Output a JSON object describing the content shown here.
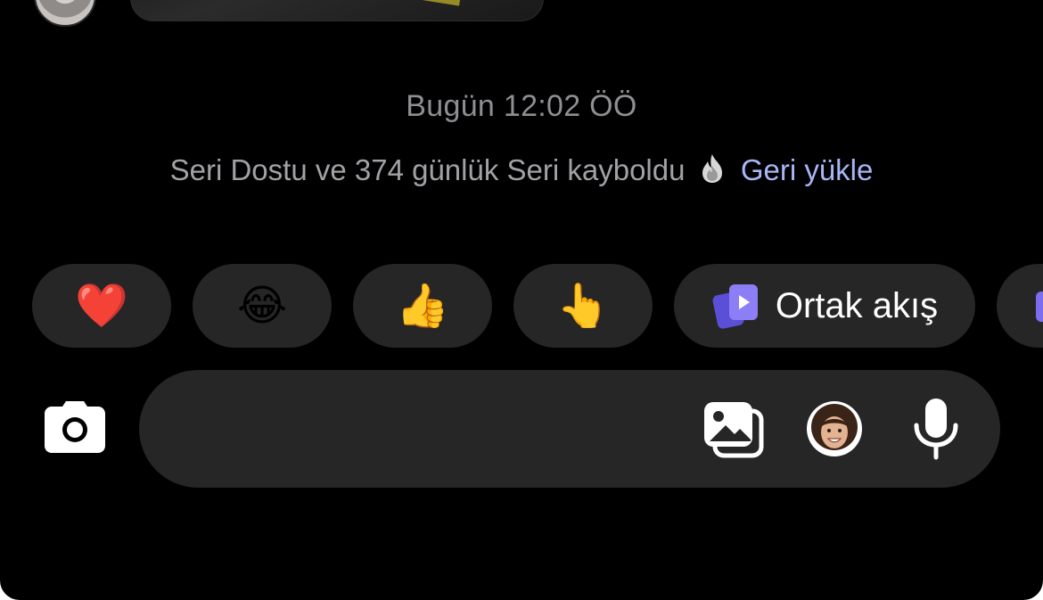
{
  "thread": {
    "timestamp": "Bugün 12:02 ÖÖ",
    "notice": {
      "text": "Seri Dostu ve 374 günlük Seri kayboldu",
      "icon": "fire-icon",
      "action_label": "Geri yükle"
    }
  },
  "quick_reactions": [
    {
      "name": "heart",
      "emoji": "❤️"
    },
    {
      "name": "laughing",
      "emoji": "😂"
    },
    {
      "name": "thumbs-up",
      "emoji": "👍"
    },
    {
      "name": "pointing",
      "emoji": "👆"
    }
  ],
  "shared_feed_chip": {
    "label": "Ortak akış",
    "icon": "shared-feed-icon"
  },
  "composer": {
    "placeholder": "",
    "icons": [
      "camera-icon",
      "gallery-icon",
      "avatar-sticker-icon",
      "microphone-icon"
    ]
  },
  "colors": {
    "background": "#000000",
    "chip": "#262626",
    "link": "#a8b6f6",
    "accent": "#7b6cf0"
  }
}
